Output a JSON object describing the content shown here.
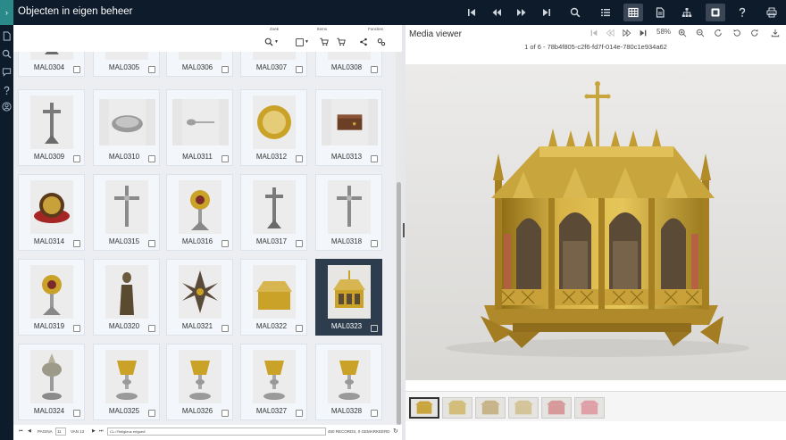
{
  "app": {
    "title": "Objecten in eigen beheer",
    "menu_glyph": "›"
  },
  "toolbar_groups": {
    "zoek": "Zoek",
    "items": "Items",
    "functies": "Functies"
  },
  "cards": [
    {
      "label": "MAL0304",
      "kind": "cross"
    },
    {
      "label": "MAL0305",
      "kind": "dish"
    },
    {
      "label": "MAL0306",
      "kind": "vessel"
    },
    {
      "label": "MAL0307",
      "kind": "vessel"
    },
    {
      "label": "MAL0308",
      "kind": "vessel"
    },
    {
      "label": "MAL0309",
      "kind": "cross"
    },
    {
      "label": "MAL0310",
      "kind": "dish"
    },
    {
      "label": "MAL0311",
      "kind": "spoon"
    },
    {
      "label": "MAL0312",
      "kind": "disc"
    },
    {
      "label": "MAL0313",
      "kind": "box"
    },
    {
      "label": "MAL0314",
      "kind": "reliquary-round"
    },
    {
      "label": "MAL0315",
      "kind": "crucifix"
    },
    {
      "label": "MAL0316",
      "kind": "monstrance"
    },
    {
      "label": "MAL0317",
      "kind": "cross"
    },
    {
      "label": "MAL0318",
      "kind": "crucifix"
    },
    {
      "label": "MAL0319",
      "kind": "monstrance"
    },
    {
      "label": "MAL0320",
      "kind": "statue"
    },
    {
      "label": "MAL0321",
      "kind": "maltese"
    },
    {
      "label": "MAL0322",
      "kind": "shrine"
    },
    {
      "label": "MAL0323",
      "kind": "shrine-gothic",
      "selected": true
    },
    {
      "label": "MAL0324",
      "kind": "ciborium"
    },
    {
      "label": "MAL0325",
      "kind": "chalice"
    },
    {
      "label": "MAL0326",
      "kind": "chalice"
    },
    {
      "label": "MAL0327",
      "kind": "chalice"
    },
    {
      "label": "MAL0328",
      "kind": "chalice"
    }
  ],
  "footer": {
    "pagina_label": "PAGINA",
    "page_value": "11",
    "of_label": "VAN 13",
    "query": "CL='Religieus erfgoed'",
    "records": "450 RECORDS, 0 GEMARKEERD"
  },
  "media_viewer": {
    "title": "Media viewer",
    "zoom": "58%",
    "caption": "1 of 6 - 78b4f805-c2f6-fd7f-014e-780c1e934a62",
    "filmstrip_count": 6
  },
  "colors": {
    "topbar": "#0d1b2a",
    "accent_teal": "#2a8a8a",
    "gold": "#c9a227",
    "selected_card": "#2d3d4d"
  }
}
